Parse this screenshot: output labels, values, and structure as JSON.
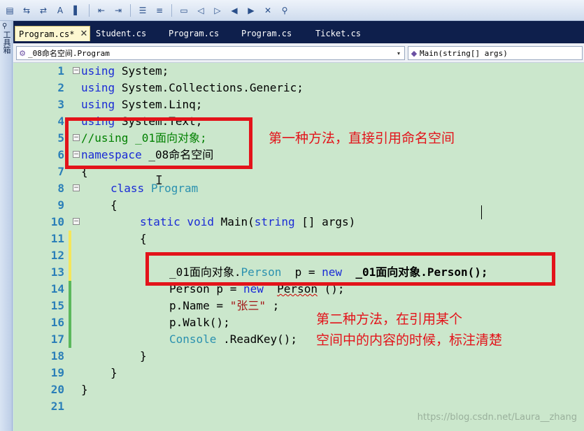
{
  "toolbar": {
    "buttons": [
      {
        "icon": "window-icon",
        "glyph": "▤"
      },
      {
        "icon": "members-icon",
        "glyph": "⇆"
      },
      {
        "icon": "signature-icon",
        "glyph": "⇄"
      },
      {
        "icon": "word-icon",
        "glyph": "A"
      },
      {
        "icon": "param-icon",
        "glyph": "▌"
      },
      {
        "icon": "outdent-icon",
        "glyph": "⇤"
      },
      {
        "icon": "indent-icon",
        "glyph": "⇥"
      },
      {
        "icon": "comment-icon",
        "glyph": "☰"
      },
      {
        "icon": "uncomment-icon",
        "glyph": "≡"
      },
      {
        "icon": "bookmark-icon",
        "glyph": "▭"
      },
      {
        "icon": "prev-bookmark-icon",
        "glyph": "◁"
      },
      {
        "icon": "next-bookmark-icon",
        "glyph": "▷"
      },
      {
        "icon": "prev-folder-icon",
        "glyph": "◀"
      },
      {
        "icon": "next-folder-icon",
        "glyph": "▶"
      },
      {
        "icon": "clear-bookmarks-icon",
        "glyph": "✕"
      },
      {
        "icon": "find-icon",
        "glyph": "⚲"
      }
    ]
  },
  "left_strip": {
    "label": "工具箱"
  },
  "tabs": [
    {
      "label": "Program.cs*",
      "active": true,
      "close": "✕"
    },
    {
      "label": "Student.cs"
    },
    {
      "label": "Program.cs"
    },
    {
      "label": "Program.cs"
    },
    {
      "label": "Ticket.cs"
    }
  ],
  "nav": {
    "type_combo": "_08命名空间.Program",
    "member_combo": "Main(string[] args)",
    "dropdown_glyph": "▾"
  },
  "code_lines": [
    {
      "n": "1",
      "fold": "⊟",
      "parts": [
        [
          "kw",
          "using"
        ],
        [
          "",
          "System;"
        ]
      ]
    },
    {
      "n": "2",
      "parts": [
        [
          "kw",
          "using"
        ],
        [
          "",
          "System.Collections.Generic;"
        ]
      ]
    },
    {
      "n": "3",
      "parts": [
        [
          "kw",
          "using"
        ],
        [
          "",
          "System.Linq;"
        ]
      ]
    },
    {
      "n": "4",
      "parts": [
        [
          "kw",
          "using"
        ],
        [
          "",
          "System.Text;"
        ]
      ]
    },
    {
      "n": "5",
      "fold": "⊟",
      "parts": [
        [
          "cm",
          "//using _01面向对象;"
        ]
      ]
    },
    {
      "n": "6",
      "fold": "⊟",
      "parts": [
        [
          "kw",
          "namespace"
        ],
        [
          "",
          "_08命名空间"
        ]
      ]
    },
    {
      "n": "7",
      "parts": [
        [
          "",
          "{"
        ]
      ]
    },
    {
      "n": "8",
      "fold": "⊟",
      "indent": 4,
      "parts": [
        [
          "kw",
          "class"
        ],
        [
          "ty",
          "Program"
        ]
      ]
    },
    {
      "n": "9",
      "indent": 4,
      "parts": [
        [
          "",
          "{"
        ]
      ]
    },
    {
      "n": "10",
      "fold": "⊟",
      "indent": 8,
      "parts": [
        [
          "kw",
          "static void"
        ],
        [
          "",
          "Main("
        ],
        [
          "kw",
          "string"
        ],
        [
          "",
          "[] args)"
        ]
      ]
    },
    {
      "n": "11",
      "indent": 8,
      "parts": [
        [
          "",
          "{"
        ]
      ]
    },
    {
      "n": "12",
      "parts": []
    },
    {
      "n": "13",
      "indent": 12,
      "parts": [
        [
          "",
          "_01面向对象."
        ],
        [
          "ty",
          "Person"
        ],
        [
          "",
          " p = "
        ],
        [
          "kw",
          "new"
        ],
        [
          "b",
          " _01面向对象.Person();"
        ]
      ]
    },
    {
      "n": "14",
      "indent": 12,
      "parts": [
        [
          "",
          "Person p = "
        ],
        [
          "kw",
          "new"
        ],
        [
          "",
          " "
        ],
        [
          "squig",
          "Person"
        ],
        [
          "",
          "();"
        ]
      ]
    },
    {
      "n": "15",
      "indent": 12,
      "parts": [
        [
          "",
          "p.Name = "
        ],
        [
          "st",
          "\"张三\""
        ],
        [
          "",
          ";"
        ]
      ]
    },
    {
      "n": "16",
      "indent": 12,
      "parts": [
        [
          "",
          "p.Walk();"
        ]
      ]
    },
    {
      "n": "17",
      "indent": 12,
      "parts": [
        [
          "ty",
          "Console"
        ],
        [
          "",
          ".ReadKey();"
        ]
      ]
    },
    {
      "n": "18",
      "indent": 8,
      "parts": [
        [
          "",
          "}"
        ]
      ]
    },
    {
      "n": "19",
      "indent": 4,
      "parts": [
        [
          "",
          "}"
        ]
      ]
    },
    {
      "n": "20",
      "parts": [
        [
          "",
          "}"
        ]
      ]
    },
    {
      "n": "21",
      "parts": []
    }
  ],
  "annotations": {
    "first": "第一种方法，直接引用命名空间",
    "second_line1": "第二种方法，在引用某个",
    "second_line2": "空间中的内容的时候，标注清楚"
  },
  "watermark": "https://blog.csdn.net/Laura__zhang",
  "colors": {
    "keyword": "#1a2bd6",
    "type": "#2b91af",
    "comment": "#008000",
    "string": "#a31515",
    "annotation": "#e3131a"
  }
}
